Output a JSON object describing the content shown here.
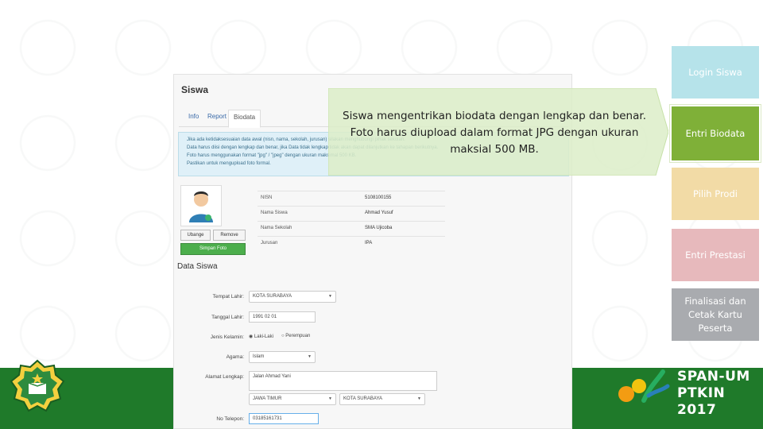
{
  "screenshot": {
    "title": "Siswa",
    "tabs": [
      "Info",
      "Report",
      "Biodata"
    ],
    "info_lines": [
      "Jika ada ketidaksesuaian data awal (nisn, nama, sekolah, jurusan) silakan menghubungi pihak sekolah.",
      "Data harus diisi dengan lengkap dan benar, jika Data tidak lengkap tidak akan dapat dilanjutkan ke tahapan berikutnya.",
      "Foto harus menggunakan format \"jpg\" / \"jpeg\" dengan ukuran maksimal 500 KB.",
      "Pastikan untuk mengupload foto formal."
    ],
    "photo_buttons": {
      "change": "Ubange",
      "remove": "Remove",
      "save": "Simpan Foto"
    },
    "student_info": [
      {
        "key": "NISN",
        "value": "5108100155"
      },
      {
        "key": "Nama Siswa",
        "value": "Ahmad Yusuf"
      },
      {
        "key": "Nama Sekolah",
        "value": "SMA Ujicoba"
      },
      {
        "key": "Jurusan",
        "value": "IPA"
      }
    ],
    "section_title": "Data Siswa",
    "form": {
      "birthplace_label": "Tempat Lahir:",
      "birthplace_value": "KOTA SURABAYA",
      "birthdate_label": "Tanggal Lahir:",
      "birthdate_value": "1991 02 01",
      "gender_label": "Jenis Kelamin:",
      "gender_options": [
        "Laki-Laki",
        "Perempuan"
      ],
      "religion_label": "Agama:",
      "religion_value": "Islam",
      "address_label": "Alamat Lengkap:",
      "address_value": "Jalan Ahmad Yani",
      "province_value": "JAWA TIMUR",
      "city_value": "KOTA SURABAYA",
      "phone_label": "No Telepon:",
      "phone_value": "03185161731"
    }
  },
  "callout": {
    "line1": "Siswa mengentrikan biodata dengan lengkap dan benar.",
    "line2": "Foto harus diupload dalam format JPG dengan ukuran",
    "line3": "maksial 500 MB."
  },
  "steps": [
    {
      "label": "Login Siswa",
      "color": "#b6e3ea"
    },
    {
      "label": "Entri Biodata",
      "color": "#7fb038"
    },
    {
      "label": "Pilih Prodi",
      "color": "#f2dba6"
    },
    {
      "label": "Entri Prestasi",
      "color": "#e7b9bc"
    },
    {
      "label": "Finalisasi dan Cetak Kartu Peserta",
      "color": "#a9abaf"
    }
  ],
  "brand": {
    "line1": "SPAN-UM",
    "line2": "PTKIN 2017"
  },
  "colors": {
    "band": "#1f7a2a",
    "info_bg": "#dff0f8",
    "save_button": "#4cae4c"
  }
}
